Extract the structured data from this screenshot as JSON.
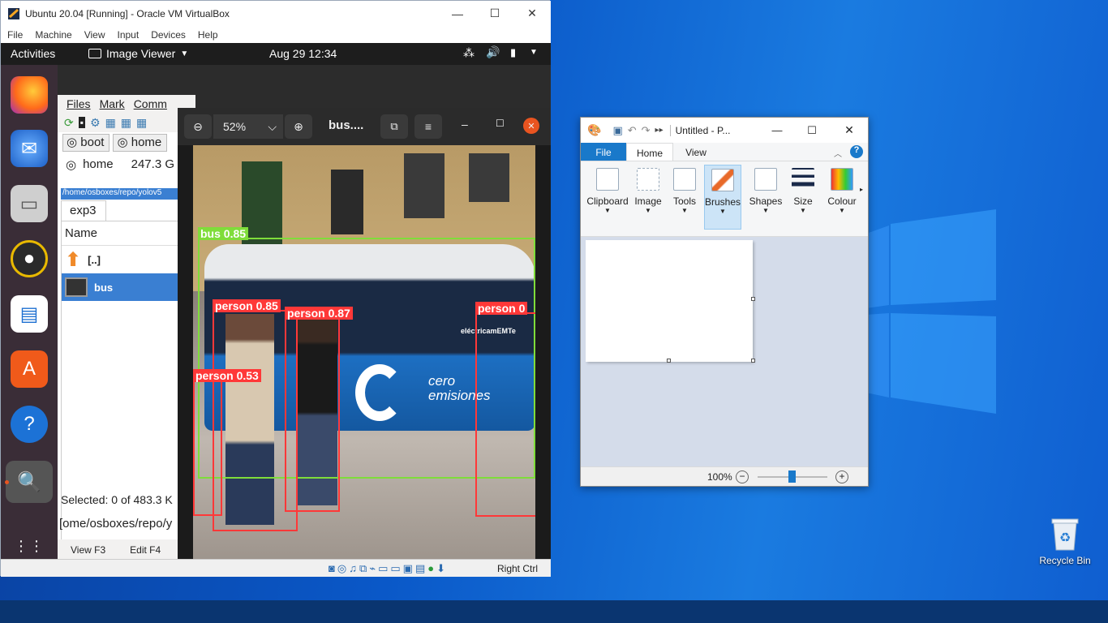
{
  "desktop": {
    "recycle_bin_label": "Recycle Bin"
  },
  "vbox": {
    "title": "Ubuntu 20.04 [Running] - Oracle VM VirtualBox",
    "menu": [
      "File",
      "Machine",
      "View",
      "Input",
      "Devices",
      "Help"
    ],
    "host_key": "Right Ctrl",
    "minimize": "—",
    "maximize": "☐",
    "close": "✕"
  },
  "ubuntu": {
    "activities": "Activities",
    "app_name": "Image Viewer",
    "clock": "Aug 29  12:34"
  },
  "file_manager": {
    "menu": [
      "Files",
      "Mark",
      "Comm"
    ],
    "drive_tabs": [
      "boot",
      "home"
    ],
    "drive_name": "home",
    "drive_size": "247.3 G",
    "path": "/home/osboxes/repo/yolov5",
    "tab": "exp3",
    "column_name": "Name",
    "rows": [
      {
        "name": "[..]"
      },
      {
        "name": "bus"
      }
    ],
    "selected": "Selected: 0 of 483.3 K",
    "cmdline": "[ome/osboxes/repo/y",
    "fkeys": [
      "View F3",
      "Edit F4"
    ]
  },
  "image_viewer": {
    "zoom": "52%",
    "title": "bus....",
    "detections": [
      {
        "label": "bus  0.85"
      },
      {
        "label": "person  0.85"
      },
      {
        "label": "person  0.87"
      },
      {
        "label": "person  0.53"
      },
      {
        "label": "person  0"
      }
    ],
    "bus_text_1": "cero",
    "bus_text_2": "emisiones",
    "bus_text_3": "eléctricamEMTe"
  },
  "paint": {
    "title": "Untitled - P...",
    "tabs": [
      "File",
      "Home",
      "View"
    ],
    "groups": [
      "Clipboard",
      "Image",
      "Tools",
      "Brushes",
      "Shapes",
      "Size",
      "Colour"
    ],
    "zoom": "100%"
  },
  "colors": {
    "accent": "#1979ca",
    "detection_red": "#ff3838",
    "bus_green": "#7fdd3a"
  }
}
